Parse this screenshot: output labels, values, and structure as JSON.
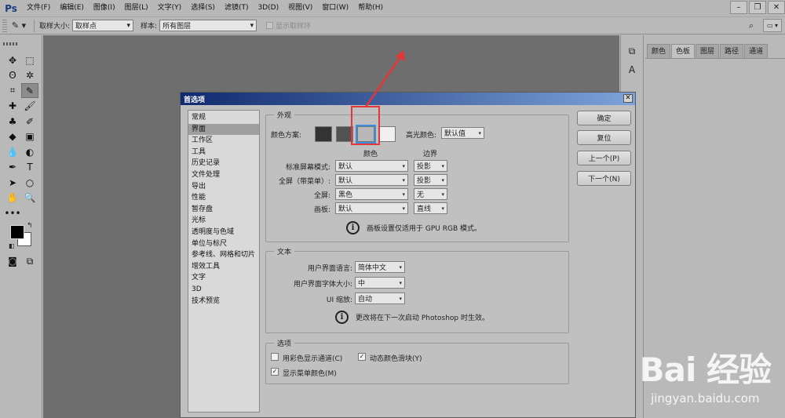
{
  "menubar": {
    "logo": "Ps",
    "items": [
      "文件(F)",
      "编辑(E)",
      "图像(I)",
      "图层(L)",
      "文字(Y)",
      "选择(S)",
      "滤镜(T)",
      "3D(D)",
      "视图(V)",
      "窗口(W)",
      "帮助(H)"
    ]
  },
  "optbar": {
    "sample_size_label": "取样大小:",
    "sample_size_value": "取样点",
    "sample_label": "样本:",
    "sample_value": "所有图层",
    "show_ring_label": "显示取样环"
  },
  "panel": {
    "tabs": [
      "颜色",
      "色板",
      "图层",
      "路径",
      "通道"
    ]
  },
  "dialog": {
    "title": "首选项",
    "nav": [
      "常规",
      "界面",
      "工作区",
      "工具",
      "历史记录",
      "文件处理",
      "导出",
      "性能",
      "暂存盘",
      "光标",
      "透明度与色域",
      "单位与标尺",
      "参考线、网格和切片",
      "增效工具",
      "文字",
      "3D",
      "技术预览"
    ],
    "selected_nav": "界面",
    "appearance": {
      "title": "外观",
      "scheme_label": "颜色方案:",
      "swatches": [
        "#333333",
        "#525252",
        "#b8b8b8",
        "#f0f0f0"
      ],
      "highlight_label": "高光颜色:",
      "highlight_value": "默认值",
      "col_color": "颜色",
      "col_border": "边界",
      "rows": [
        {
          "label": "标准屏幕模式:",
          "color": "默认",
          "border": "投影"
        },
        {
          "label": "全屏（带菜单）:",
          "color": "默认",
          "border": "投影"
        },
        {
          "label": "全屏:",
          "color": "黑色",
          "border": "无"
        },
        {
          "label": "画板:",
          "color": "默认",
          "border": "直线"
        }
      ],
      "note": "画板设置仅适用于 GPU RGB 模式。"
    },
    "text": {
      "title": "文本",
      "lang_label": "用户界面语言:",
      "lang_value": "简体中文",
      "size_label": "用户界面字体大小:",
      "size_value": "中",
      "scale_label": "UI 缩放:",
      "scale_value": "自动",
      "note": "更改将在下一次启动 Photoshop 时生效。"
    },
    "options": {
      "title": "选项",
      "channels_label": "用彩色显示通道(C)",
      "dynamic_label": "动态颜色滑块(Y)",
      "menu_colors_label": "显示菜单颜色(M)"
    },
    "buttons": {
      "ok": "确定",
      "reset": "复位",
      "prev": "上一个(P)",
      "next": "下一个(N)"
    }
  },
  "watermark": {
    "logo": "Bai 经验",
    "url": "jingyan.baidu.com"
  }
}
